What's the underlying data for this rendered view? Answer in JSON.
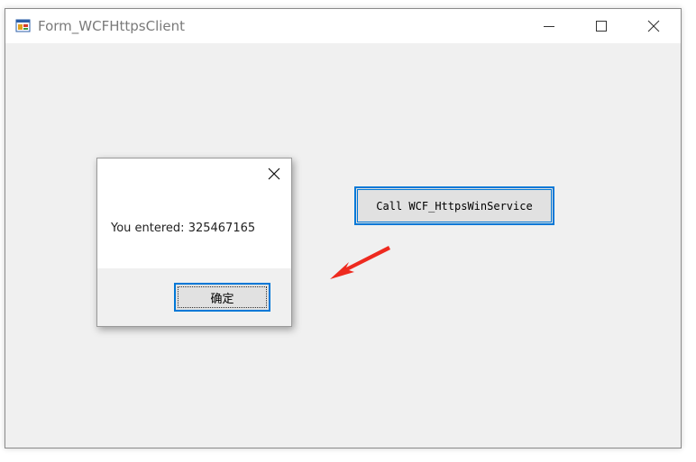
{
  "window": {
    "title": "Form_WCFHttpsClient",
    "icon": "winforms-app-icon",
    "controls": [
      "minimize-icon",
      "maximize-icon",
      "close-icon"
    ]
  },
  "main": {
    "call_button_label": "Call WCF_HttpsWinService"
  },
  "messagebox": {
    "message": "You entered: 325467165",
    "ok_label": "确定",
    "close_icon": "close-icon"
  },
  "annotation": {
    "arrow_color": "#ee2a1f",
    "arrow_icon": "red-arrow-icon"
  },
  "colors": {
    "accent": "#0078d7",
    "window_bg": "#f0f0f0"
  }
}
